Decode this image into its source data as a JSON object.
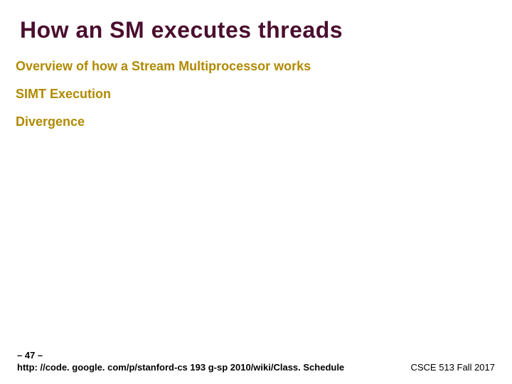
{
  "title": "How an SM executes threads",
  "bullets": [
    "Overview of how a Stream Multiprocessor works",
    "SIMT Execution",
    "Divergence"
  ],
  "footer": {
    "page_marker": "– 47 –",
    "url": "http: //code. google. com/p/stanford-cs 193 g-sp 2010/wiki/Class. Schedule",
    "course": "CSCE 513 Fall 2017"
  }
}
